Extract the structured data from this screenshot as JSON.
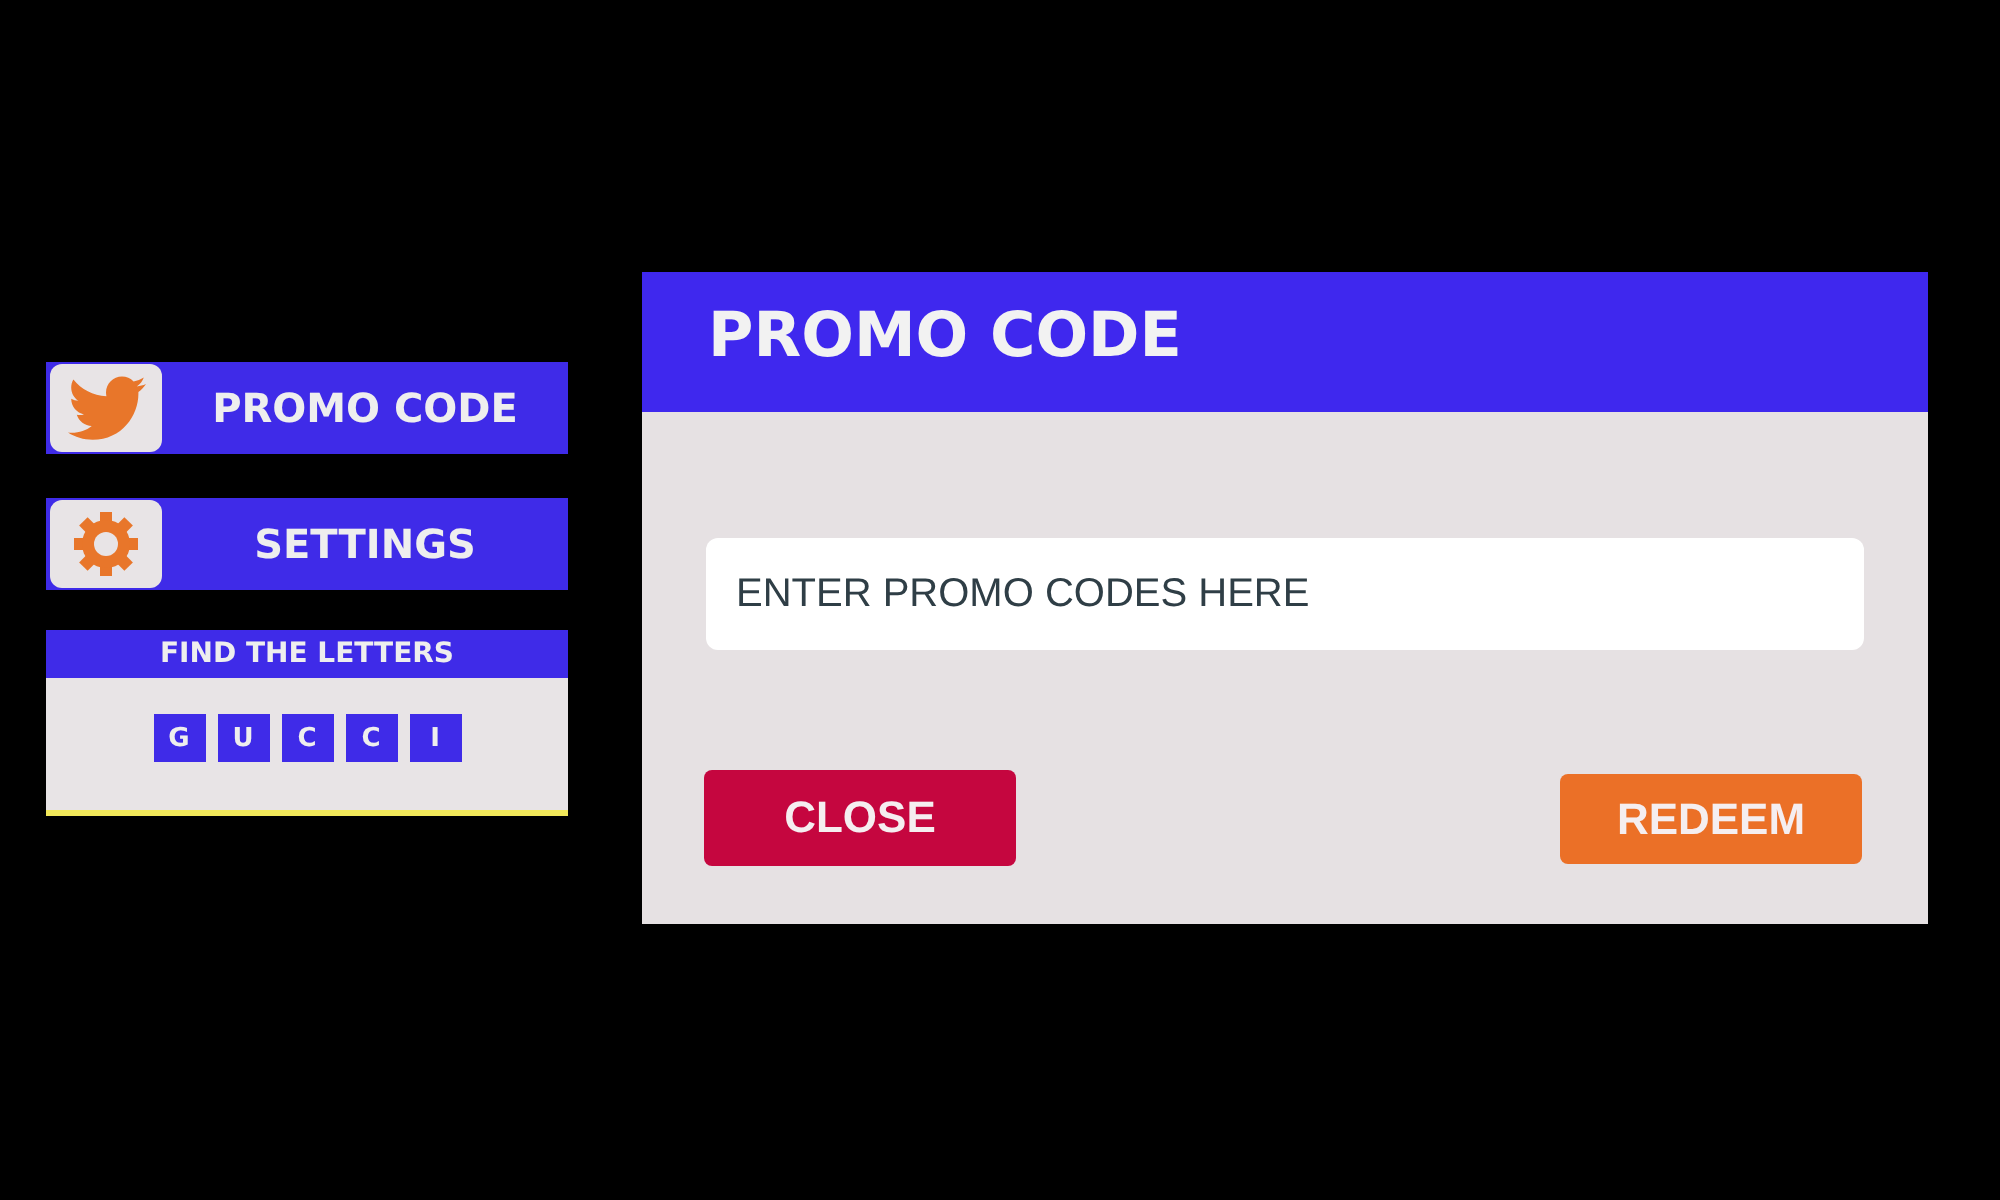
{
  "menu": [
    {
      "label": "PROMO CODE",
      "kind": "bird"
    },
    {
      "label": "SETTINGS",
      "kind": "gear"
    }
  ],
  "letters_panel": {
    "title": "FIND THE LETTERS",
    "letters": [
      "G",
      "U",
      "C",
      "C",
      "I"
    ]
  },
  "dialog": {
    "title": "PROMO CODE",
    "field": {
      "placeholder": "ENTER PROMO CODES HERE"
    },
    "buttons": [
      {
        "label": "CLOSE",
        "kind": "secondary"
      },
      {
        "label": "REDEEM",
        "kind": "primary"
      }
    ]
  }
}
